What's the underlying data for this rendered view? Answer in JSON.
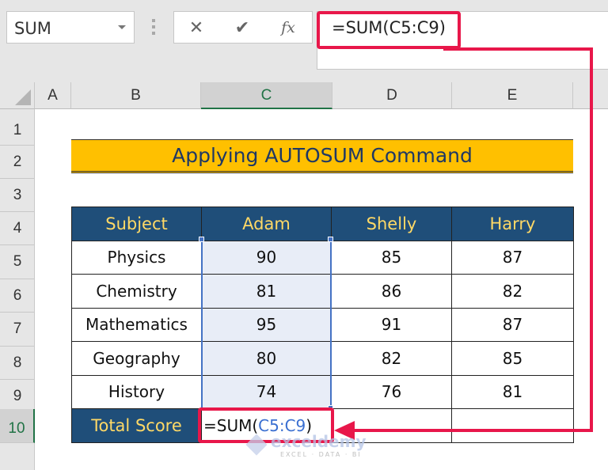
{
  "formula_bar": {
    "name_box": "SUM",
    "cancel_icon": "✕",
    "enter_icon": "✔",
    "fx_label": "fx",
    "formula": "=SUM(C5:C9)"
  },
  "columns": [
    "A",
    "B",
    "C",
    "D",
    "E"
  ],
  "active_column": "C",
  "rows": [
    "1",
    "2",
    "3",
    "4",
    "5",
    "6",
    "7",
    "8",
    "9",
    "10"
  ],
  "active_row": "10",
  "sheet": {
    "title": "Applying AUTOSUM Command",
    "headers": [
      "Subject",
      "Adam",
      "Shelly",
      "Harry"
    ],
    "data": [
      {
        "subject": "Physics",
        "adam": "90",
        "shelly": "85",
        "harry": "87"
      },
      {
        "subject": "Chemistry",
        "adam": "81",
        "shelly": "86",
        "harry": "82"
      },
      {
        "subject": "Mathematics",
        "adam": "95",
        "shelly": "91",
        "harry": "87"
      },
      {
        "subject": "Geography",
        "adam": "80",
        "shelly": "82",
        "harry": "85"
      },
      {
        "subject": "History",
        "adam": "74",
        "shelly": "76",
        "harry": "81"
      }
    ],
    "total_label": "Total Score",
    "editing_formula": {
      "prefix": "=SUM(",
      "range": "C5:C9",
      "suffix": ")"
    },
    "total_shelly": "",
    "total_harry": ""
  },
  "watermark": {
    "name": "exceldemy",
    "tagline": "EXCEL · DATA · BI"
  },
  "colors": {
    "highlight": "#e8174a",
    "header_bg": "#1f4e79",
    "header_text": "#ffd966",
    "title_bg": "#ffc000",
    "selection": "#4472c4"
  }
}
